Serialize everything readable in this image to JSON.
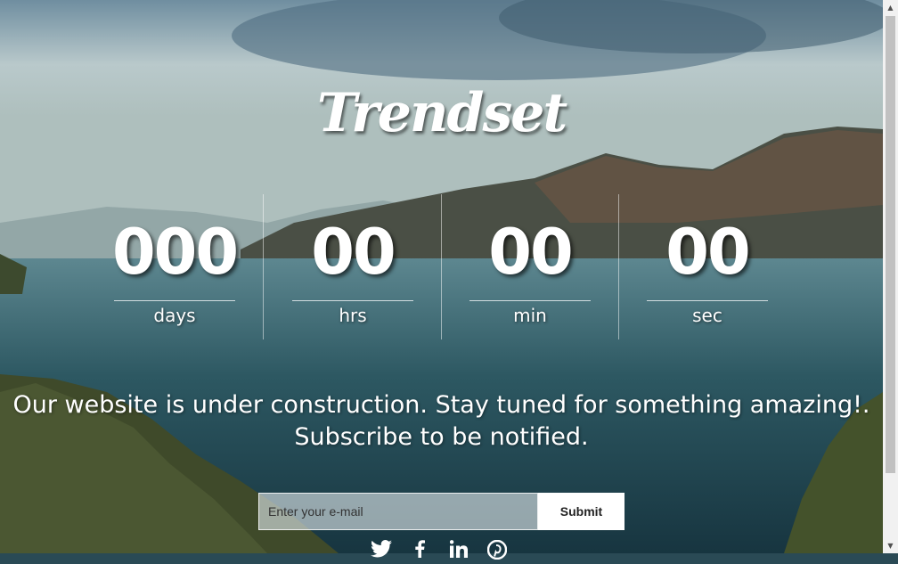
{
  "brand": {
    "logo_text": "Trendset"
  },
  "countdown": {
    "days": {
      "value": "000",
      "label": "days"
    },
    "hrs": {
      "value": "00",
      "label": "hrs"
    },
    "min": {
      "value": "00",
      "label": "min"
    },
    "sec": {
      "value": "00",
      "label": "sec"
    }
  },
  "message": {
    "line1": "Our website is under construction. Stay tuned for something amazing!.",
    "line2": "Subscribe to be notified."
  },
  "subscribe": {
    "email_placeholder": "Enter your e-mail",
    "submit_label": "Submit"
  },
  "social": {
    "twitter_icon": "twitter-icon",
    "facebook_icon": "facebook-icon",
    "linkedin_icon": "linkedin-icon",
    "pinterest_icon": "pinterest-icon"
  },
  "scrollbar": {
    "up_arrow": "▲",
    "down_arrow": "▼"
  }
}
